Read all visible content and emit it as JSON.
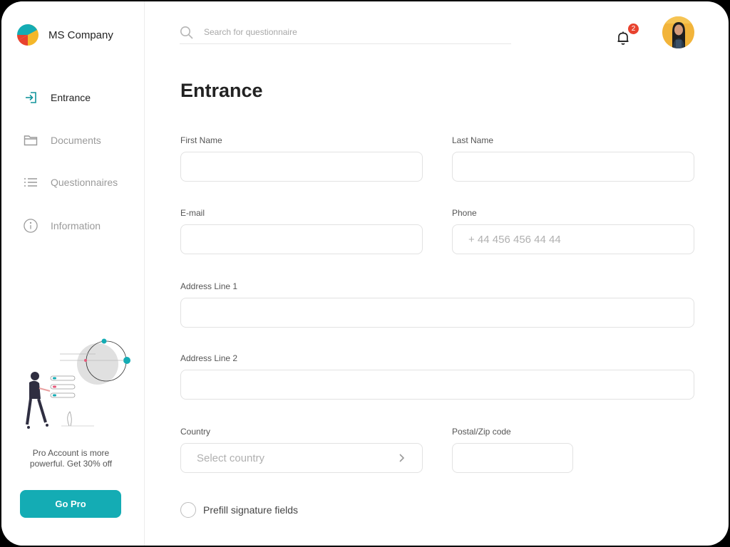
{
  "brand": {
    "name": "MS Company",
    "logo_icon": "company-logo-icon"
  },
  "sidebar": {
    "items": [
      {
        "label": "Entrance",
        "icon": "enter-icon",
        "active": true
      },
      {
        "label": "Documents",
        "icon": "folder-icon",
        "active": false
      },
      {
        "label": "Questionnaires",
        "icon": "list-icon",
        "active": false
      },
      {
        "label": "Information",
        "icon": "info-icon",
        "active": false
      }
    ],
    "promo_text": "Pro Account is more powerful. Get 30% off",
    "go_pro_label": "Go Pro"
  },
  "header": {
    "search_placeholder": "Search for questionnaire",
    "notifications_count": "2"
  },
  "form": {
    "title": "Entrance",
    "first_name_label": "First Name",
    "last_name_label": "Last Name",
    "email_label": "E-mail",
    "phone_label": "Phone",
    "phone_placeholder": "+ 44 456 456 44 44",
    "address1_label": "Address Line 1",
    "address2_label": "Address Line 2",
    "country_label": "Country",
    "country_placeholder": "Select country",
    "postal_label": "Postal/Zip code",
    "prefill_label": "Prefill signature fields",
    "prefill_checked": false
  },
  "colors": {
    "accent": "#14acb4",
    "badge": "#e8422e",
    "active_text": "#222222",
    "inactive_text": "#9a9a9a"
  }
}
